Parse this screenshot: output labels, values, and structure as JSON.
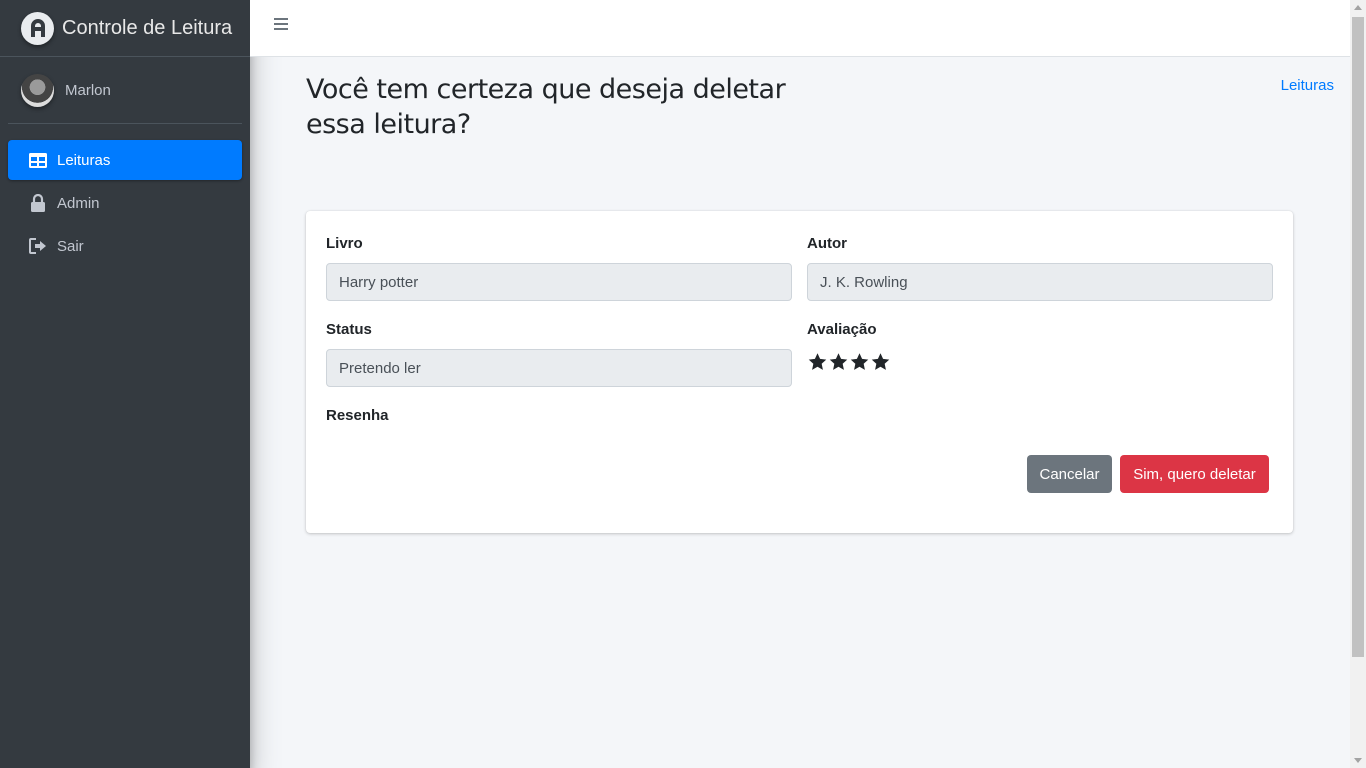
{
  "brand": {
    "title": "Controle de Leitura"
  },
  "user": {
    "name": "Marlon"
  },
  "nav": [
    {
      "label": "Leituras",
      "icon": "table-icon",
      "active": true
    },
    {
      "label": "Admin",
      "icon": "lock-icon",
      "active": false
    },
    {
      "label": "Sair",
      "icon": "sign-out-icon",
      "active": false
    }
  ],
  "header": {
    "title": "Você tem certeza que deseja deletar essa leitura?",
    "breadcrumb": "Leituras"
  },
  "form": {
    "livro_label": "Livro",
    "livro_value": "Harry potter",
    "autor_label": "Autor",
    "autor_value": "J. K. Rowling",
    "status_label": "Status",
    "status_value": "Pretendo ler",
    "avaliacao_label": "Avaliação",
    "avaliacao_stars": 4,
    "resenha_label": "Resenha"
  },
  "actions": {
    "cancel_label": "Cancelar",
    "delete_label": "Sim, quero deletar"
  },
  "colors": {
    "sidebar": "#343a40",
    "primary": "#007bff",
    "secondary": "#6c757d",
    "danger": "#dc3545"
  }
}
